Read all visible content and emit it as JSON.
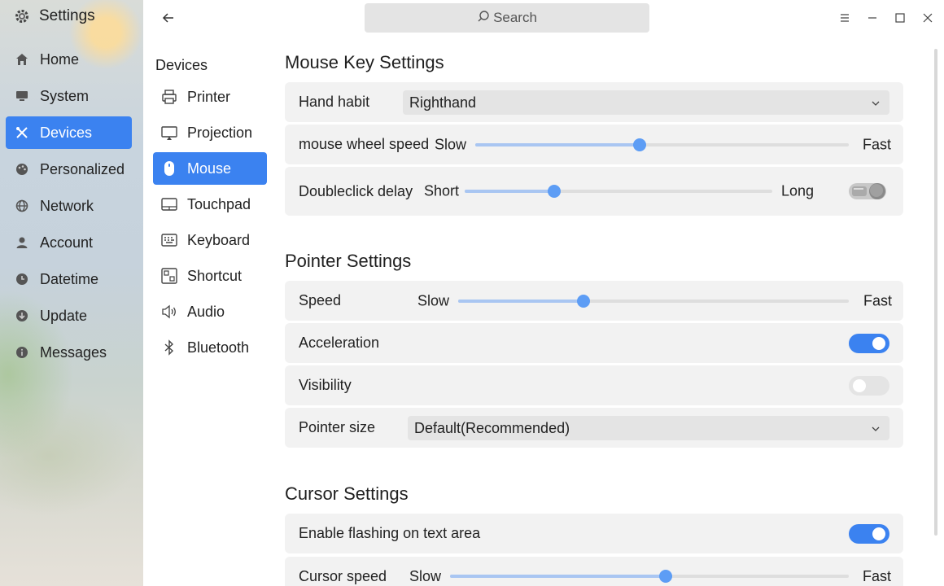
{
  "app": {
    "title": "Settings",
    "icon": "gear-icon"
  },
  "nav": {
    "items": [
      {
        "label": "Home",
        "icon": "home-icon",
        "active": false
      },
      {
        "label": "System",
        "icon": "monitor-icon",
        "active": false
      },
      {
        "label": "Devices",
        "icon": "devices-icon",
        "active": true
      },
      {
        "label": "Personalized",
        "icon": "palette-icon",
        "active": false
      },
      {
        "label": "Network",
        "icon": "globe-icon",
        "active": false
      },
      {
        "label": "Account",
        "icon": "person-icon",
        "active": false
      },
      {
        "label": "Datetime",
        "icon": "clock-icon",
        "active": false
      },
      {
        "label": "Update",
        "icon": "update-icon",
        "active": false
      },
      {
        "label": "Messages",
        "icon": "info-icon",
        "active": false
      }
    ]
  },
  "search": {
    "placeholder": "Search"
  },
  "subnav": {
    "title": "Devices",
    "items": [
      {
        "label": "Printer",
        "icon": "printer-icon",
        "active": false
      },
      {
        "label": "Projection",
        "icon": "projection-icon",
        "active": false
      },
      {
        "label": "Mouse",
        "icon": "mouse-icon",
        "active": true
      },
      {
        "label": "Touchpad",
        "icon": "touchpad-icon",
        "active": false
      },
      {
        "label": "Keyboard",
        "icon": "keyboard-icon",
        "active": false
      },
      {
        "label": "Shortcut",
        "icon": "shortcut-icon",
        "active": false
      },
      {
        "label": "Audio",
        "icon": "audio-icon",
        "active": false
      },
      {
        "label": "Bluetooth",
        "icon": "bluetooth-icon",
        "active": false
      }
    ]
  },
  "mouse_keys": {
    "title": "Mouse Key Settings",
    "hand_habit": {
      "label": "Hand habit",
      "value": "Righthand"
    },
    "wheel_speed": {
      "label": "mouse wheel speed",
      "min_label": "Slow",
      "max_label": "Fast",
      "level": 0.44
    },
    "doubleclick": {
      "label": "Doubleclick  delay",
      "min_label": "Short",
      "max_label": "Long",
      "level": 0.29
    }
  },
  "pointer": {
    "title": "Pointer Settings",
    "speed": {
      "label": "Speed",
      "min_label": "Slow",
      "max_label": "Fast",
      "level": 0.32
    },
    "acceleration": {
      "label": "Acceleration",
      "on": true
    },
    "visibility": {
      "label": "Visibility",
      "on": false
    },
    "size": {
      "label": "Pointer size",
      "value": "Default(Recommended)"
    }
  },
  "cursor": {
    "title": "Cursor Settings",
    "flashing": {
      "label": "Enable flashing on text area",
      "on": true
    },
    "speed": {
      "label": "Cursor speed",
      "min_label": "Slow",
      "max_label": "Fast",
      "level": 0.54
    }
  },
  "colors": {
    "accent": "#3b82f0",
    "slider_knob": "#5d9df5",
    "slider_fill": "#a9c6f2",
    "card_bg": "#f2f2f2"
  }
}
